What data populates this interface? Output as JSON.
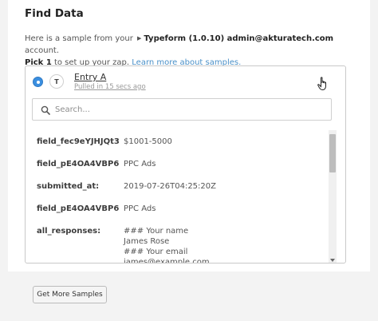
{
  "header": {
    "title": "Find Data"
  },
  "description": {
    "prefix": "Here is a sample from your",
    "app_icon": "typeform-icon",
    "app_name": "Typeform (1.0.10) admin@akturatech.com",
    "suffix": "account.",
    "pick": "Pick 1",
    "pick_suffix": "to set up your zap.",
    "learn_more": "Learn more about samples."
  },
  "entry": {
    "avatar_letter": "T",
    "title": "Entry A",
    "pulled": "Pulled in 15 secs ago"
  },
  "search": {
    "placeholder": "Search..."
  },
  "fields": [
    {
      "name": "field_fec9eYJHJQt3:",
      "value": "$1001-5000"
    },
    {
      "name": "field_pE4OA4VBP6...",
      "value": "PPC Ads"
    },
    {
      "name": "submitted_at:",
      "value": "2019-07-26T04:25:20Z"
    },
    {
      "name": "field_pE4OA4VBP6...",
      "value": "PPC Ads"
    },
    {
      "name": "all_responses:",
      "value": "### Your name\nJames Rose\n### Your email\njames@example.com"
    }
  ],
  "footer": {
    "get_more_label": "Get More Samples"
  },
  "colors": {
    "accent": "#3b8fe0",
    "link": "#4a90c8"
  }
}
